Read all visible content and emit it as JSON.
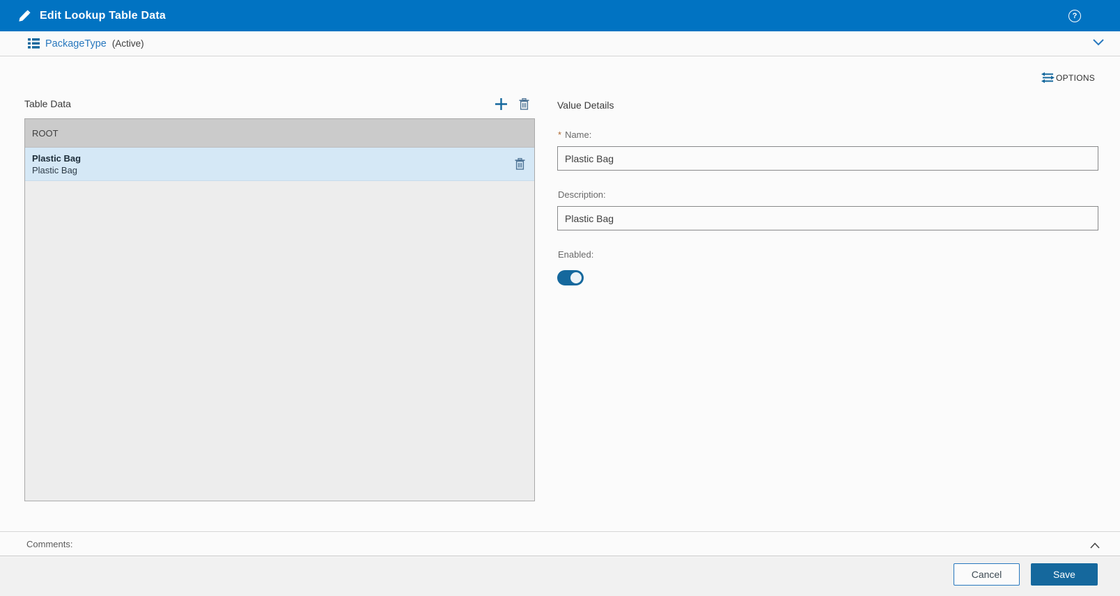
{
  "header": {
    "title": "Edit Lookup Table Data",
    "help_label": "?"
  },
  "subheader": {
    "lookup_name": "PackageType",
    "status": "(Active)"
  },
  "toolbar": {
    "options_label": "OPTIONS"
  },
  "table_panel": {
    "title": "Table Data",
    "root_label": "ROOT",
    "rows": [
      {
        "name": "Plastic Bag",
        "description": "Plastic Bag",
        "selected": true
      }
    ]
  },
  "details_panel": {
    "title": "Value Details",
    "required_marker": "*",
    "name_label": "Name:",
    "name_value": "Plastic Bag",
    "description_label": "Description:",
    "description_value": "Plastic Bag",
    "enabled_label": "Enabled:",
    "enabled_state": true
  },
  "comments": {
    "label": "Comments:"
  },
  "footer": {
    "cancel_label": "Cancel",
    "save_label": "Save"
  },
  "colors": {
    "titlebar_blue": "#0173C2",
    "link_blue": "#2878BE",
    "accent_dark_blue": "#15689D",
    "selected_row_blue": "#D5E8F6",
    "table_header_gray": "#CBCBCB",
    "list_bg_gray": "#EDEDED",
    "footer_gray": "#F1F1F1",
    "required_orange": "#AF6932"
  }
}
